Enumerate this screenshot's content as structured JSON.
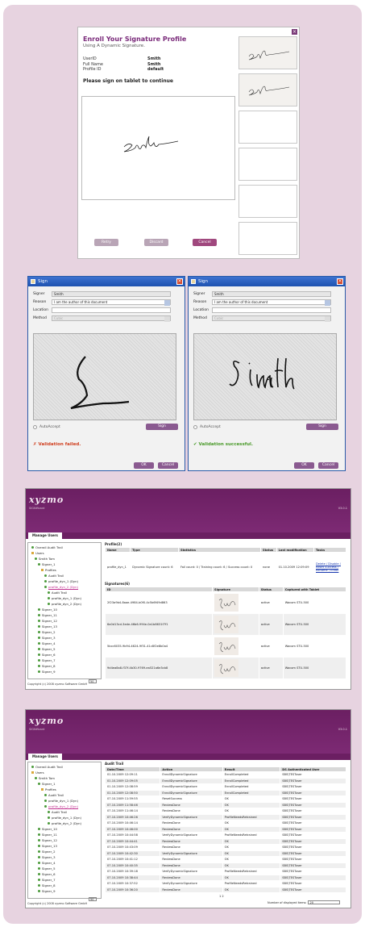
{
  "colors": {
    "frame": "#e7d3e0",
    "brand": "#7a2a7a",
    "dialog_title": "#2a5aa8",
    "fail": "#d04020",
    "success": "#4a9a2a"
  },
  "enroll": {
    "title": "Enroll Your Signature Profile",
    "subtitle": "Using A Dynamic Signature.",
    "fields": [
      {
        "label": "UserID",
        "value": "Smith"
      },
      {
        "label": "Full Name",
        "value": "Smith"
      },
      {
        "label": "Profile ID",
        "value": "default"
      }
    ],
    "prompt": "Please sign on tablet to continue",
    "buttons": {
      "retry": "Retry",
      "discard": "Discard",
      "cancel": "Cancel"
    },
    "thumbnail_count": 6,
    "close_icon": "close-icon"
  },
  "sign_dialogs": [
    {
      "title": "Sign",
      "signer_label": "Signer",
      "signer_value": "Smith",
      "reason_label": "Reason",
      "reason_value": "I am the author of this document",
      "location_label": "Location",
      "location_value": "",
      "method_label": "Method",
      "method_value": "Cubic",
      "autocrop_label": "AutoAccept",
      "sign_button": "Sign",
      "validation_text": "Validation failed.",
      "validation_state": "fail",
      "ok_button": "OK",
      "cancel_button": "Cancel"
    },
    {
      "title": "Sign",
      "signer_label": "Signer",
      "signer_value": "Smith",
      "reason_label": "Reason",
      "reason_value": "I am the author of this document",
      "location_label": "Location",
      "location_value": "",
      "method_label": "Method",
      "method_value": "Cubic",
      "autocrop_label": "AutoAccept",
      "sign_button": "Sign",
      "validation_text": "Validation successful.",
      "validation_state": "success",
      "ok_button": "OK",
      "cancel_button": "Cancel"
    }
  ],
  "app_profiles": {
    "logo": "xyzmo",
    "tagline": "SIGNificant",
    "version": "V3.0.1",
    "tab": "Manage Users",
    "tree": [
      "Overall Audit Trail",
      "Users",
      "Smith Tom",
      "Signer_1",
      "Profiles",
      "Audit Trail",
      "profile_dyn_1 (Dyn)",
      "profile_dyn_2 (Dyn)",
      "Audit Trail",
      "profile_dyn_1 (Dyn)",
      "profile_dyn_2 (Dyn)",
      "Signer_10",
      "Signer_11",
      "Signer_12",
      "Signer_13",
      "Signer_2",
      "Signer_3",
      "Signer_4",
      "Signer_5",
      "Signer_6",
      "Signer_7",
      "Signer_8",
      "Signer_9"
    ],
    "copyright": "Copyright (c) 2008 xyzmo Software GmbH",
    "page_size": "50",
    "profile_title": "Profile(2)",
    "profile_headers": [
      "Name",
      "Type",
      "Statistics",
      "Status",
      "Last modification",
      "Tasks"
    ],
    "profile_row": [
      "profile_dyn_1",
      "Dynamic Signature count: 6",
      "Fail count: 0 / Training count: 6 / Success count: 0",
      "none",
      "01.10.2009 12:09:09",
      "Delete / Disable / Reset Success / Rename / Enroll"
    ],
    "signatures_title": "Signatures(6)",
    "signature_headers": [
      "ID",
      "Signature",
      "Status",
      "Captured with Tablet"
    ],
    "signatures": [
      [
        "2f23a9b4-8aae-4984-b0f0-4c5b6f49d863",
        "active",
        "Wacom STU-500"
      ],
      [
        "6a0d13cd-3ede-46b6-994e-0a1b8631f7f1",
        "active",
        "Wacom STU-500"
      ],
      [
        "5bcc6035-9b94-4624-9f31-41c8f2e8b0a4",
        "active",
        "Wacom STU-500"
      ],
      [
        "9d4ea8a8-f37f-4b30-9769-ea521a6e3cb8",
        "active",
        "Wacom STU-500"
      ]
    ]
  },
  "app_audit": {
    "logo": "xyzmo",
    "tagline": "SIGNificant",
    "version": "V3.0.1",
    "tab": "Manage Users",
    "tree": [
      "Overall Audit Trail",
      "Users",
      "Smith Tom",
      "Signer_1",
      "Profiles",
      "Audit Trail",
      "profile_dyn_1 (Dyn)",
      "profile_dyn_2 (Dyn)",
      "Audit Trail",
      "profile_dyn_1 (Dyn)",
      "profile_dyn_2 (Dyn)",
      "Signer_10",
      "Signer_11",
      "Signer_12",
      "Signer_13",
      "Signer_2",
      "Signer_3",
      "Signer_4",
      "Signer_5",
      "Signer_6",
      "Signer_7",
      "Signer_8",
      "Signer_9"
    ],
    "copyright": "Copyright (c) 2008 xyzmo Software GmbH",
    "page_size": "50",
    "audit_title": "Audit Trail",
    "headers": [
      "Date/Time",
      "Action",
      "Result",
      "DS Authenticated User"
    ],
    "rows": [
      [
        "01.10.2009 12:09:11",
        "EnrollDynamicSignature",
        "EnrollCompleted",
        "SBS\\TESTuser"
      ],
      [
        "01.10.2009 12:09:05",
        "EnrollDynamicSignature",
        "EnrollCompleted",
        "SBS\\TESTuser"
      ],
      [
        "01.10.2009 12:08:59",
        "EnrollDynamicSignature",
        "EnrollCompleted",
        "SBS\\TESTuser"
      ],
      [
        "01.10.2009 12:08:50",
        "EnrollDynamicSignature",
        "EnrollCompleted",
        "SBS\\TESTuser"
      ],
      [
        "07.10.2009 11:59:55",
        "ResetSuccess",
        "OK",
        "SBS\\TESTuser"
      ],
      [
        "07.10.2009 11:58:46",
        "ReviewDone",
        "OK",
        "SBS\\TESTuser"
      ],
      [
        "07.10.2009 11:46:14",
        "ReviewDone",
        "OK",
        "SBS\\TESTuser"
      ],
      [
        "07.10.2009 10:46:26",
        "VerifyDynamicSignature",
        "ProfileNeedsRetrained",
        "SBS\\TESTuser"
      ],
      [
        "07.10.2009 10:46:14",
        "ReviewDone",
        "OK",
        "SBS\\TESTuser"
      ],
      [
        "07.10.2009 10:46:00",
        "ReviewDone",
        "OK",
        "SBS\\TESTuser"
      ],
      [
        "07.10.2009 10:44:58",
        "VerifyDynamicSignature",
        "ProfileNeedsRetrained",
        "SBS\\TESTuser"
      ],
      [
        "07.10.2009 10:44:41",
        "ReviewDone",
        "OK",
        "SBS\\TESTuser"
      ],
      [
        "07.10.2009 10:43:09",
        "ReviewDone",
        "OK",
        "SBS\\TESTuser"
      ],
      [
        "07.10.2009 10:42:30",
        "VerifyDynamicSignature",
        "OK",
        "SBS\\TESTuser"
      ],
      [
        "07.10.2009 10:41:12",
        "ReviewDone",
        "OK",
        "SBS\\TESTuser"
      ],
      [
        "07.10.2009 10:40:35",
        "ReviewDone",
        "OK",
        "SBS\\TESTuser"
      ],
      [
        "07.10.2009 10:39:18",
        "VerifyDynamicSignature",
        "ProfileNeedsRetrained",
        "SBS\\TESTuser"
      ],
      [
        "07.10.2009 10:38:44",
        "ReviewDone",
        "OK",
        "SBS\\TESTuser"
      ],
      [
        "07.10.2009 10:37:52",
        "VerifyDynamicSignature",
        "ProfileNeedsRetrained",
        "SBS\\TESTuser"
      ],
      [
        "07.10.2009 10:36:20",
        "ReviewDone",
        "OK",
        "SBS\\TESTuser"
      ]
    ],
    "pager": "1 2",
    "per_page_label": "Number of displayed items:",
    "per_page_value": "20"
  }
}
